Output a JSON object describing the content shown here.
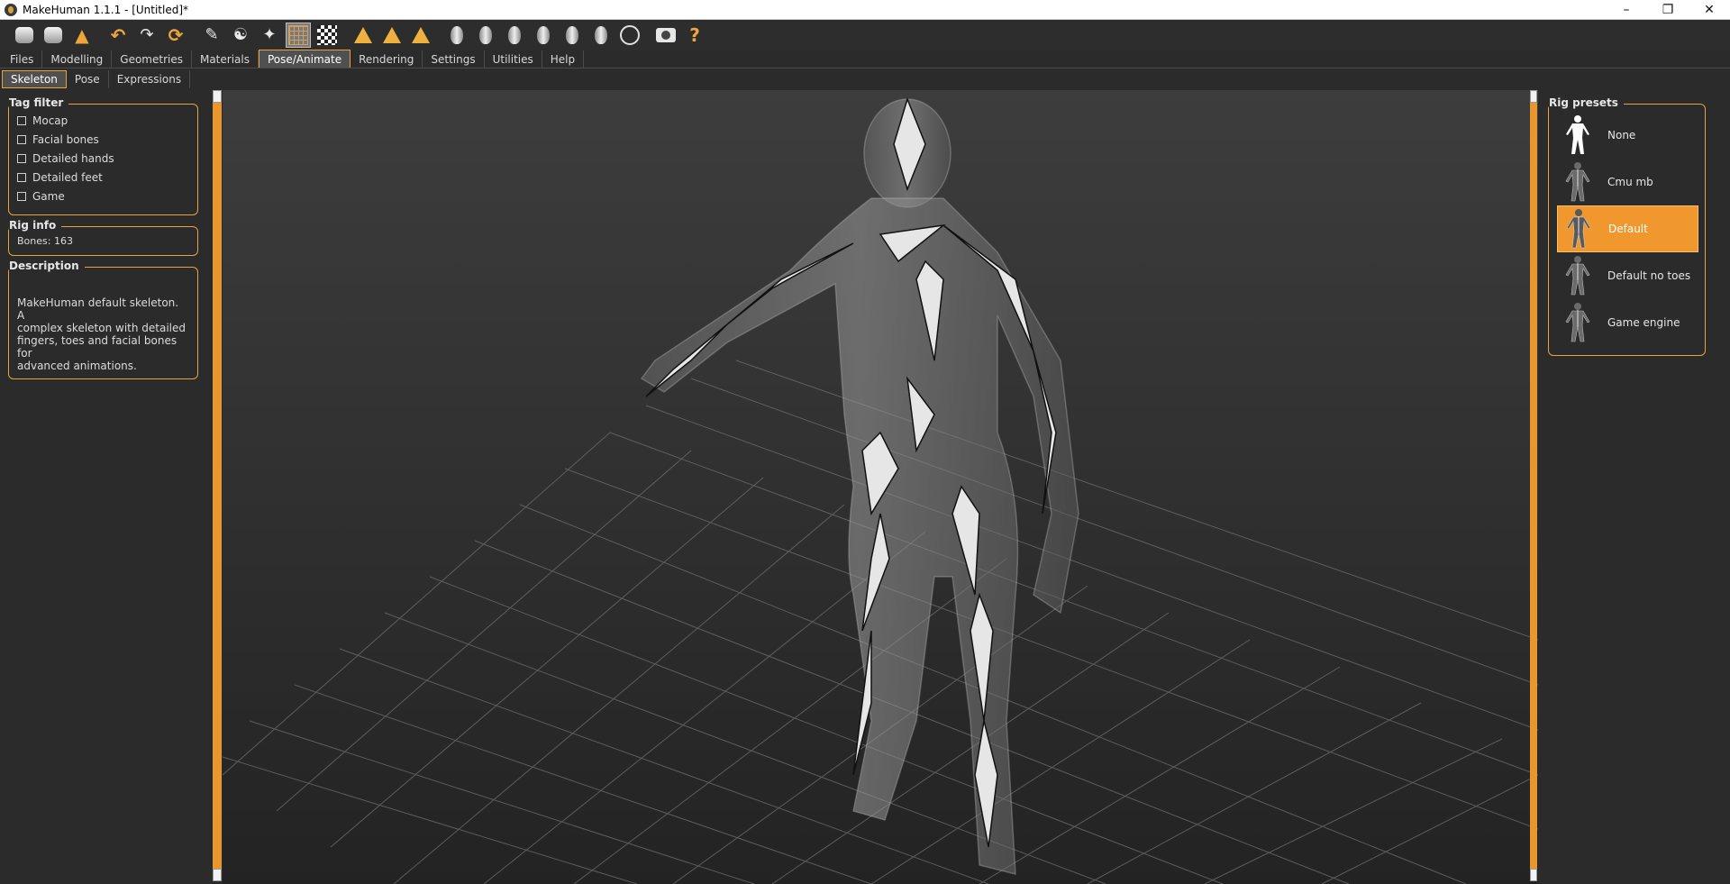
{
  "window": {
    "title": "MakeHuman 1.1.1 - [Untitled]*",
    "minimize": "–",
    "maximize": "❐",
    "close": "✕"
  },
  "toolbar": {
    "help_glyph": "?"
  },
  "menu": {
    "tabs": [
      "Files",
      "Modelling",
      "Geometries",
      "Materials",
      "Pose/Animate",
      "Rendering",
      "Settings",
      "Utilities",
      "Help"
    ],
    "active": "Pose/Animate"
  },
  "subtabs": {
    "tabs": [
      "Skeleton",
      "Pose",
      "Expressions"
    ],
    "active": "Skeleton"
  },
  "left": {
    "tag_filter": {
      "title": "Tag filter",
      "items": [
        "Mocap",
        "Facial bones",
        "Detailed hands",
        "Detailed feet",
        "Game"
      ]
    },
    "rig_info": {
      "title": "Rig info",
      "bones": "Bones: 163"
    },
    "description": {
      "title": "Description",
      "lines": [
        "MakeHuman default skeleton. A",
        "complex skeleton with detailed",
        "fingers, toes and facial bones for",
        "advanced animations."
      ]
    }
  },
  "right": {
    "rig_presets": {
      "title": "Rig presets",
      "items": [
        "None",
        "Cmu mb",
        "Default",
        "Default no toes",
        "Game engine"
      ],
      "selected": "Default"
    }
  },
  "colors": {
    "accent": "#e8a33a",
    "background": "#2b2b2b",
    "selected": "#f0982e"
  }
}
